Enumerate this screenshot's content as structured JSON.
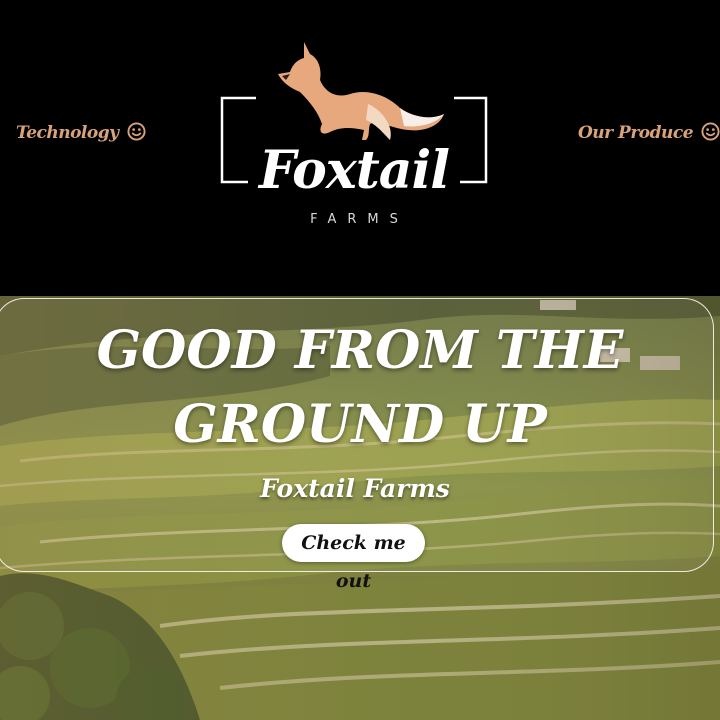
{
  "nav": {
    "left": {
      "label": "Technology",
      "icon": "smiley-icon"
    },
    "right": {
      "label": "Our Produce",
      "icon": "smiley-icon"
    }
  },
  "logo": {
    "name": "Foxtail",
    "subtitle": "FARMS",
    "icon": "fox-icon"
  },
  "hero": {
    "title": "GOOD FROM THE GROUND UP",
    "subtitle": "Foxtail Farms",
    "cta_label": "Check me out",
    "background": "terraced-rice-fields-photo"
  },
  "colors": {
    "header_bg": "#000000",
    "accent": "#d9a37a",
    "text": "#ffffff"
  }
}
